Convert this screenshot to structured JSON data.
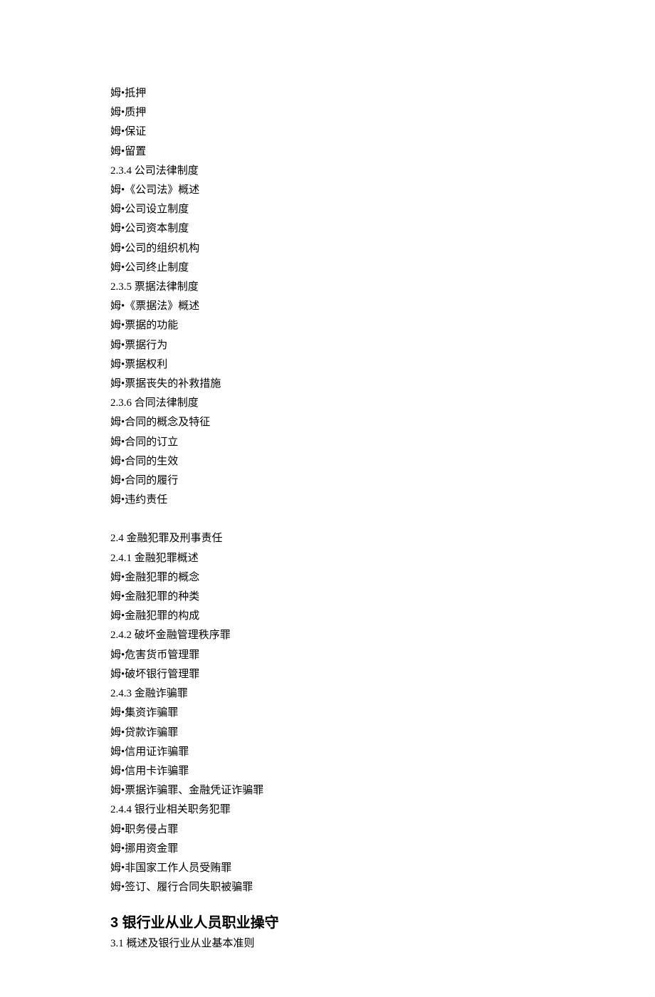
{
  "lines": [
    {
      "text": "姆•抵押"
    },
    {
      "text": "姆•质押"
    },
    {
      "text": "姆•保证"
    },
    {
      "text": "姆•留置"
    },
    {
      "text": "2.3.4 公司法律制度"
    },
    {
      "text": "姆•《公司法》概述"
    },
    {
      "text": "姆•公司设立制度"
    },
    {
      "text": "姆•公司资本制度"
    },
    {
      "text": "姆•公司的组织机构"
    },
    {
      "text": "姆•公司终止制度"
    },
    {
      "text": "2.3.5 票据法律制度"
    },
    {
      "text": "姆•《票据法》概述"
    },
    {
      "text": "姆•票据的功能"
    },
    {
      "text": "姆•票据行为"
    },
    {
      "text": "姆•票据权利"
    },
    {
      "text": "姆•票据丧失的补救措施"
    },
    {
      "text": "2.3.6 合同法律制度"
    },
    {
      "text": "姆•合同的概念及特征"
    },
    {
      "text": "姆•合同的订立"
    },
    {
      "text": "姆•合同的生效"
    },
    {
      "text": "姆•合同的履行"
    },
    {
      "text": "姆•违约责任"
    },
    {
      "gap": true
    },
    {
      "text": "2.4 金融犯罪及刑事责任"
    },
    {
      "text": "2.4.1 金融犯罪概述"
    },
    {
      "text": "姆•金融犯罪的概念"
    },
    {
      "text": "姆•金融犯罪的种类"
    },
    {
      "text": "姆•金融犯罪的构成"
    },
    {
      "text": "2.4.2 破坏金融管理秩序罪"
    },
    {
      "text": "姆•危害货币管理罪"
    },
    {
      "text": "姆•破坏银行管理罪"
    },
    {
      "text": "2.4.3 金融诈骗罪"
    },
    {
      "text": "姆•集资诈骗罪"
    },
    {
      "text": "姆•贷款诈骗罪"
    },
    {
      "text": "姆•信用证诈骗罪"
    },
    {
      "text": "姆•信用卡诈骗罪"
    },
    {
      "text": "姆•票据诈骗罪、金融凭证诈骗罪"
    },
    {
      "text": "2.4.4 银行业相关职务犯罪"
    },
    {
      "text": "姆•职务侵占罪"
    },
    {
      "text": "姆•挪用资金罪"
    },
    {
      "text": "姆•非国家工作人员受贿罪"
    },
    {
      "text": "姆•签订、履行合同失职被骗罪"
    }
  ],
  "heading3": "3 银行业从业人员职业操守",
  "line_after_heading": "3.1 概述及银行业从业基本准则"
}
